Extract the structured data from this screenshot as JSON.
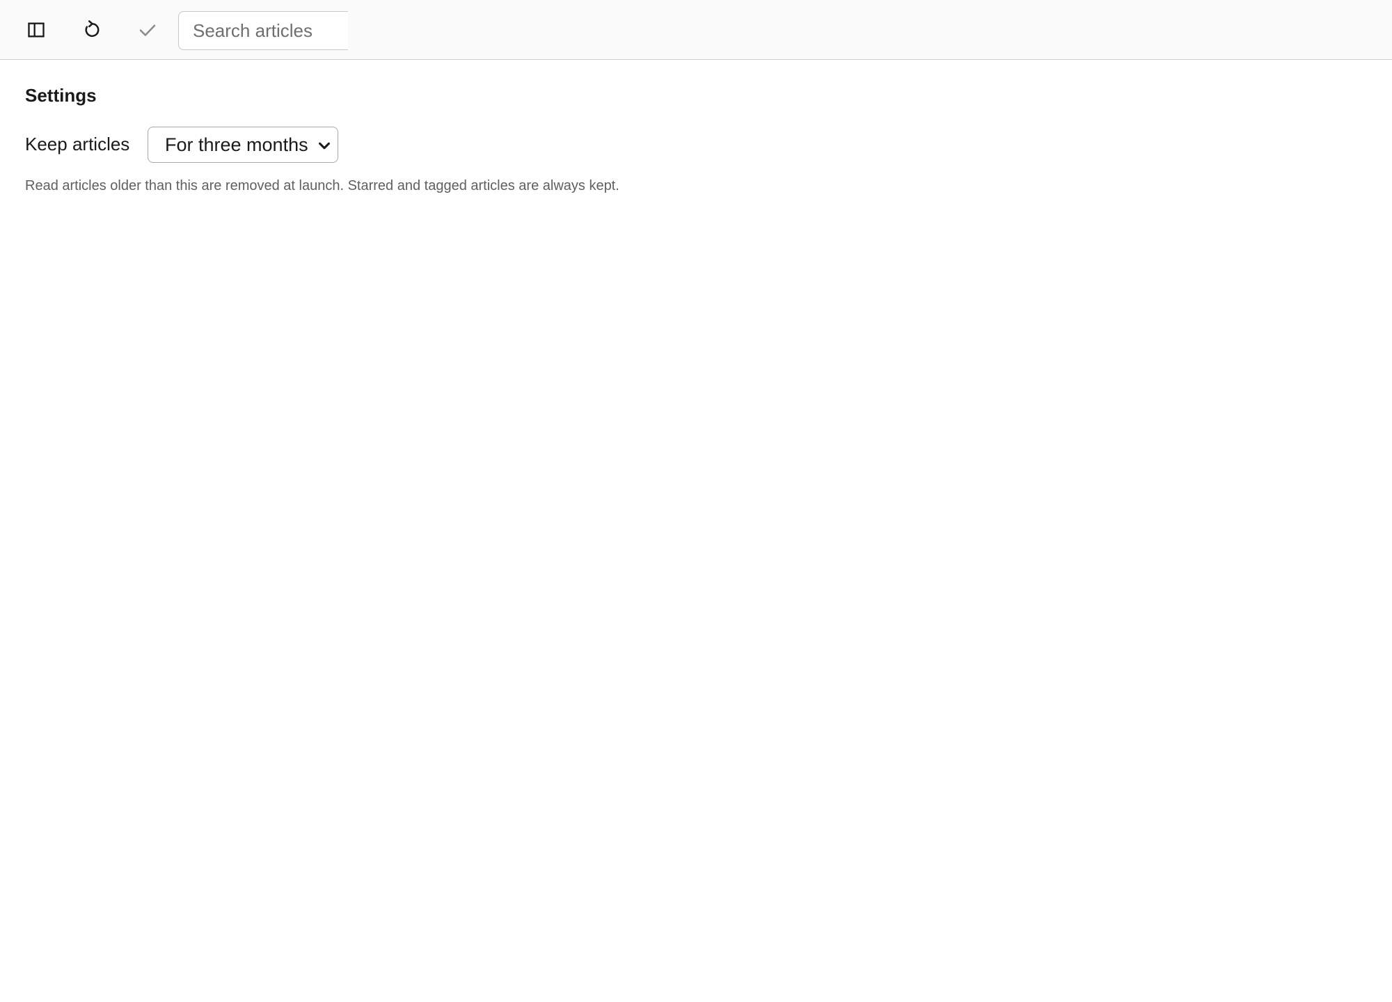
{
  "toolbar": {
    "icons": {
      "sidebar": "sidebar-toggle-icon",
      "refresh": "refresh-icon",
      "mark_read": "checkmark-icon"
    },
    "search": {
      "placeholder": "Search articles",
      "value": ""
    }
  },
  "settings": {
    "title": "Settings",
    "keep_articles": {
      "label": "Keep articles",
      "selected": "For three months",
      "help": "Read articles older than this are removed at launch. Starred and tagged articles are always kept."
    }
  },
  "colors": {
    "toolbar_bg": "#fafafa",
    "border": "#cfcfcf",
    "text": "#1a1a1a",
    "muted_text": "#5f5f5f",
    "disabled_icon": "#8a8a8a"
  }
}
